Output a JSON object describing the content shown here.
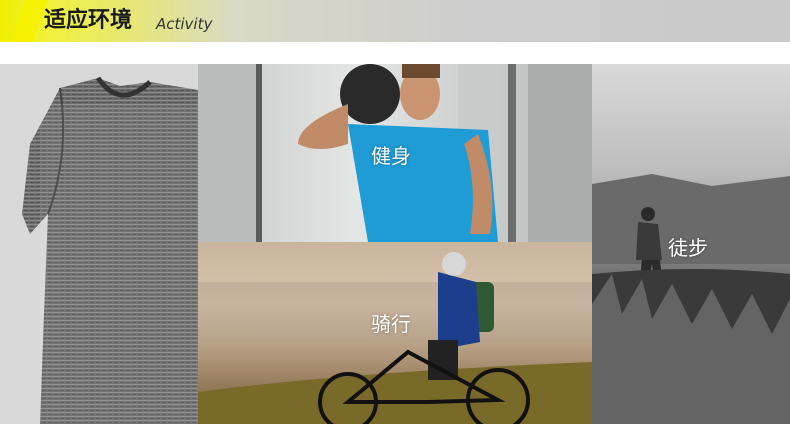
{
  "header": {
    "title_cn": "适应环境",
    "title_en": "Activity"
  },
  "panels": {
    "fitness_label": "健身",
    "cycling_label": "骑行",
    "hiking_label": "徒步"
  },
  "colors": {
    "accent": "#f5f100",
    "header_gray": "#cdcdcd"
  }
}
